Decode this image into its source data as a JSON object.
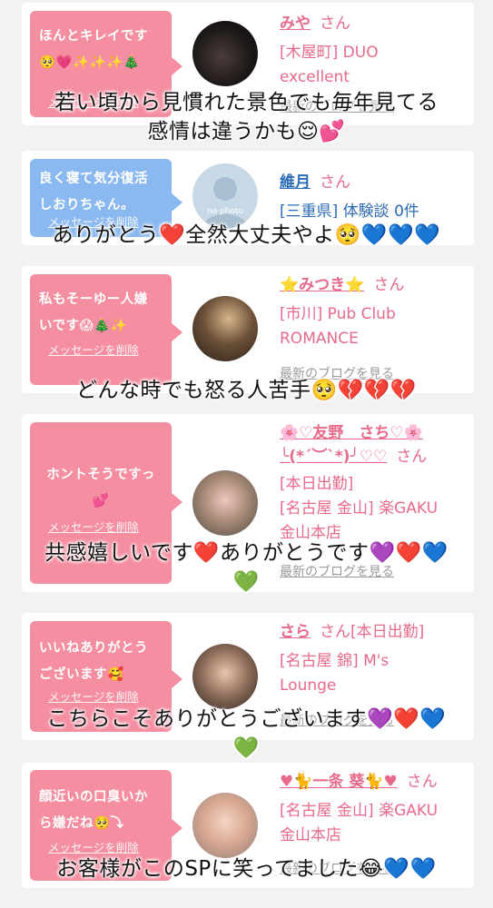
{
  "cards": [
    {
      "message": "ほんとキレイです\n🥺💗✨✨✨🎄",
      "delete_label": "メッセージを削除",
      "name": "みや",
      "san": "さん",
      "detail": "[木屋町] DUO\nexcellent",
      "blog_label": "最新のブログを見る"
    },
    {
      "message": "良く寝て気分復活\nしおりちゃん。",
      "delete_label": "メッセージを削除",
      "name": "維月",
      "san": "さん",
      "detail": "[三重県] 体験談 0件",
      "avatar_text": "no photo"
    },
    {
      "message": "私もそーゆー人嫌\nいです😱🎄✨",
      "delete_label": "メッセージを削除",
      "name": "⭐みつき⭐",
      "san": "さん",
      "detail": "[市川] Pub Club\nROMANCE",
      "blog_label": "最新のブログを見る"
    },
    {
      "message": "ホントそうですっ\n💕",
      "delete_label": "メッセージを削除",
      "name": "🌸♡友野　さち♡🌸\n╰(*´︶`*)╯♡♡",
      "san": "さん",
      "detail": "[本日出勤]\n[名古屋 金山] 楽GAKU\n金山本店",
      "blog_label": "最新のブログを見る"
    },
    {
      "message": "いいねありがとう\nございます🥰",
      "delete_label": "メッセージを削除",
      "name": "さら",
      "san": "さん[本日出勤]",
      "detail": "[名古屋 錦] M's\nLounge",
      "blog_label": "最新のブログを見る"
    },
    {
      "message": "顔近いの口臭いか\nら嫌だね🥺⤵",
      "delete_label": "メッセージを削除",
      "name": "♥🐈一条 葵🐈♥",
      "san": "さん",
      "detail": "[名古屋 金山] 楽GAKU\n金山本店",
      "blog_label": "最新のブログを見る"
    }
  ],
  "overlays": [
    "若い頃から見慣れた景色でも毎年見てる\n感情は違うかも😌💕",
    "ありがとう❤️全然大丈夫やよ🥺💙💙💙",
    "どんな時でも怒る人苦手🥺💔💔💔",
    "共感嬉しいです❤️ありがとうです💜❤️💙\n💚",
    "こちらこそありがとうございます💜❤️💙\n💚",
    "お客様がこのSPに笑ってました😂💙💙"
  ]
}
